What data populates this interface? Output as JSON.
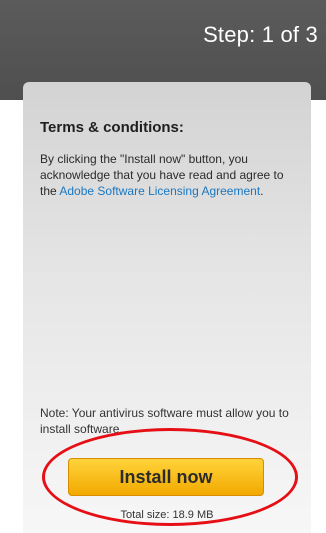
{
  "header": {
    "step_text": "Step: 1 of 3"
  },
  "terms": {
    "title": "Terms & conditions:",
    "body_before_link": "By clicking the \"Install now\" button, you acknowledge that you have read and agree to the ",
    "link_text": "Adobe Software Licensing Agreement",
    "body_after_link": "."
  },
  "note": {
    "text": "Note: Your antivirus software must allow you to install software."
  },
  "install": {
    "button_label": "Install now",
    "total_size": "Total size: 18.9 MB"
  },
  "colors": {
    "header_bg": "#555555",
    "link": "#1a78c2",
    "button_top": "#ffd33a",
    "button_bottom": "#f2a900",
    "highlight_ring": "#e50f15"
  }
}
